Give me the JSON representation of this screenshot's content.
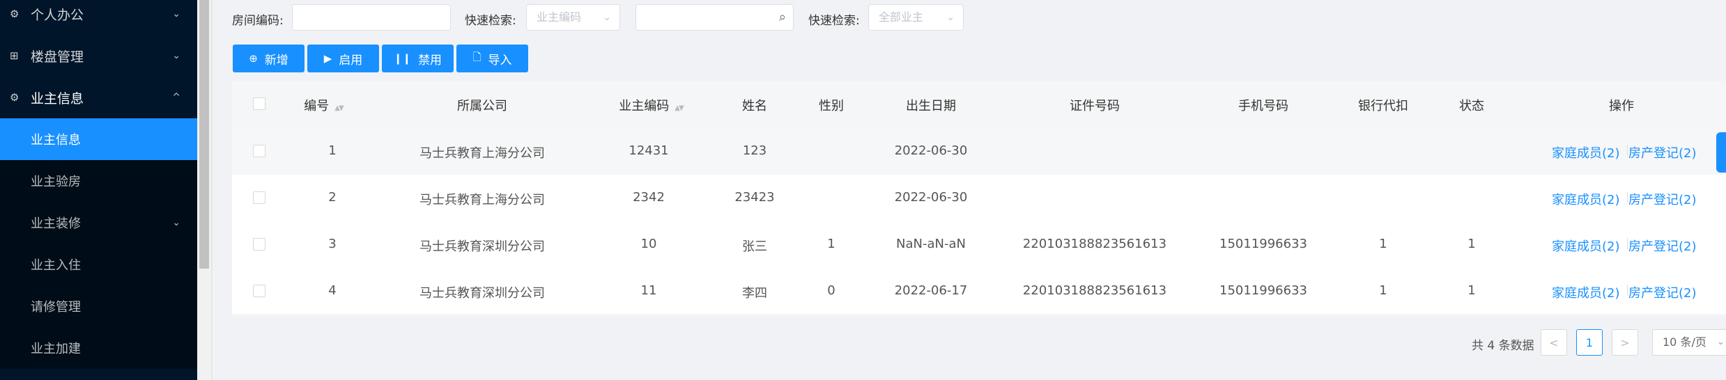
{
  "sidebar": {
    "items": [
      {
        "label": "个人办公",
        "icon": "settings-icon",
        "arrow": "⌄"
      },
      {
        "label": "楼盘管理",
        "icon": "grid-icon",
        "arrow": "⌄"
      },
      {
        "label": "业主信息",
        "icon": "settings-icon",
        "arrow": "^"
      }
    ],
    "sub_items": [
      {
        "label": "业主信息",
        "active": true
      },
      {
        "label": "业主验房"
      },
      {
        "label": "业主装修",
        "arrow": "⌄"
      },
      {
        "label": "业主入住"
      },
      {
        "label": "请修管理"
      },
      {
        "label": "业主加建"
      }
    ]
  },
  "filters": {
    "room_code_label": "房间编码:",
    "room_code_value": "",
    "quick_search_label_1": "快速检索:",
    "quick_search_select_1": "业主编码",
    "search_value": "",
    "quick_search_label_2": "快速检索:",
    "quick_search_select_2": "全部业主"
  },
  "toolbar": {
    "add": "新增",
    "enable": "启用",
    "disable": "禁用",
    "import": "导入"
  },
  "table": {
    "headers": [
      "编号",
      "所属公司",
      "业主编码",
      "姓名",
      "性别",
      "出生日期",
      "证件号码",
      "手机号码",
      "银行代扣",
      "状态",
      "操作"
    ],
    "rows": [
      {
        "id": "1",
        "company": "马士兵教育上海分公司",
        "owner_code": "12431",
        "name": "123",
        "gender": "",
        "birth": "2022-06-30",
        "id_no": "",
        "phone": "",
        "bank": "",
        "status": ""
      },
      {
        "id": "2",
        "company": "马士兵教育上海分公司",
        "owner_code": "2342",
        "name": "23423",
        "gender": "",
        "birth": "2022-06-30",
        "id_no": "",
        "phone": "",
        "bank": "",
        "status": ""
      },
      {
        "id": "3",
        "company": "马士兵教育深圳分公司",
        "owner_code": "10",
        "name": "张三",
        "gender": "1",
        "birth": "NaN-aN-aN",
        "id_no": "220103188823561613",
        "phone": "15011996633",
        "bank": "1",
        "status": "1"
      },
      {
        "id": "4",
        "company": "马士兵教育深圳分公司",
        "owner_code": "11",
        "name": "李四",
        "gender": "0",
        "birth": "2022-06-17",
        "id_no": "220103188823561613",
        "phone": "15011996633",
        "bank": "1",
        "status": "1"
      }
    ],
    "actions": {
      "family": "家庭成员(2)",
      "property": "房产登记(2)"
    }
  },
  "pagination": {
    "total": "共 4 条数据",
    "prev": "<",
    "current": "1",
    "next": ">",
    "page_size": "10 条/页"
  },
  "colors": {
    "primary": "#1890ff",
    "sidebar": "#001529"
  }
}
